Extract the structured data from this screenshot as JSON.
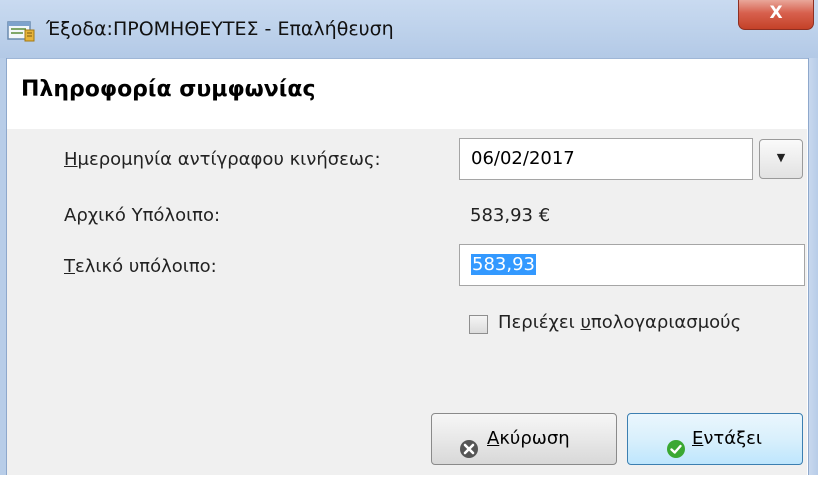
{
  "window": {
    "title": "Έξοδα:ΠΡΟΜΗΘΕΥΤΕΣ - Επαλήθευση",
    "close_label": "X",
    "app_icon": "ledger-window-icon"
  },
  "section": {
    "title": "Πληροφορία συμφωνίας"
  },
  "fields": {
    "date_label_accel": "Η",
    "date_label_rest": "μερομηνία αντίγραφου κινήσεως:",
    "date_value": "06/02/2017",
    "dropdown_arrow": "▼",
    "opening_label": "Αρχικό Υπόλοιπο:",
    "opening_value": "583,93 €",
    "final_label_accel": "Τ",
    "final_label_rest": "ελικό υπόλοιπο:",
    "final_value": "583,93"
  },
  "checkbox": {
    "label_pre": "Περιέχει ",
    "label_accel": "υ",
    "label_rest": "πολογαριασμούς",
    "checked": false
  },
  "buttons": {
    "cancel_accel": "Α",
    "cancel_rest": "κύρωση",
    "cancel_icon": "cancel-circle-x-icon",
    "ok_accel": "Ε",
    "ok_rest": "ντάξει",
    "ok_icon": "ok-checkmark-icon"
  },
  "colors": {
    "titlebar": "#bfd3ec",
    "close_button": "#c44128",
    "selection": "#3399ff",
    "ok_icon": "#3aa832",
    "cancel_icon": "#555555"
  }
}
